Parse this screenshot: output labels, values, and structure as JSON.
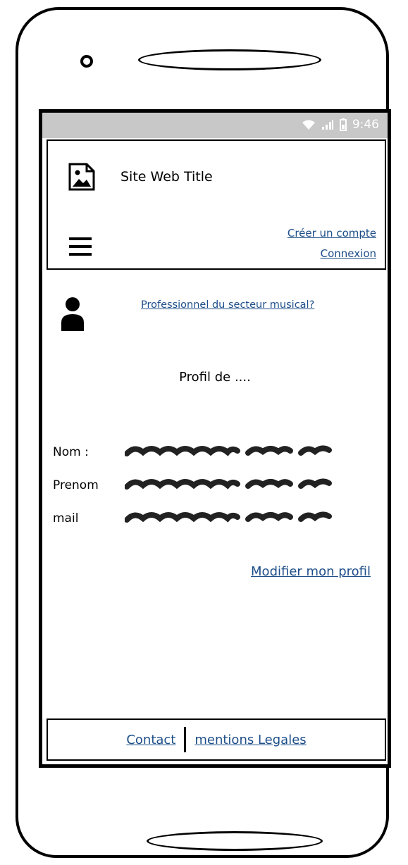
{
  "status_bar": {
    "time": "9:46",
    "icons": [
      "wifi-icon",
      "signal-icon",
      "battery-icon"
    ]
  },
  "header": {
    "logo_icon": "image-placeholder-icon",
    "title": "Site Web Title",
    "menu_icon": "hamburger-menu-icon",
    "links": {
      "create_account": "Créer un compte",
      "login": "Connexion"
    }
  },
  "main": {
    "user_icon": "user-icon",
    "pro_link": "Professionnel du secteur musical?",
    "profile_title": "Profil de ....",
    "fields": [
      {
        "label": "Nom :",
        "value_redacted": true
      },
      {
        "label": "Prenom",
        "value_redacted": true
      },
      {
        "label": "mail",
        "value_redacted": true
      }
    ],
    "edit_profile_link": "Modifier mon profil"
  },
  "footer": {
    "contact": "Contact",
    "legal": "mentions Legales"
  },
  "colors": {
    "link": "#1d4e89",
    "status_bar_bg": "#c8c8c8",
    "outline": "#000000"
  }
}
